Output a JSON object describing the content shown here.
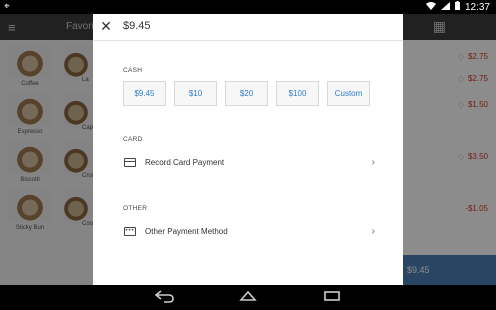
{
  "status_bar": {
    "time": "12:37",
    "left_icon": "location-icon",
    "icons": [
      "wifi-icon",
      "signal-icon",
      "battery-icon"
    ]
  },
  "background_app": {
    "toolbar_title": "Favori",
    "tiles": [
      {
        "label": "Coffee"
      },
      {
        "label": "Espresso"
      },
      {
        "label": "Biscotti"
      },
      {
        "label": "Sticky Bun"
      }
    ],
    "partial_tiles": [
      {
        "label": "La"
      },
      {
        "label": "Capp"
      },
      {
        "label": "Crois"
      },
      {
        "label": "Coo"
      }
    ],
    "cart_prices": [
      "$2.75",
      "$2.75",
      "$1.50",
      "$3.50",
      "-$1.05"
    ],
    "charge_label": "$9.45"
  },
  "dialog": {
    "title_amount": "$9.45",
    "cash": {
      "label": "CASH",
      "buttons": [
        "$9.45",
        "$10",
        "$20",
        "$100",
        "Custom"
      ]
    },
    "card": {
      "label": "CARD",
      "row_text": "Record Card Payment"
    },
    "other": {
      "label": "OTHER",
      "row_text": "Other Payment Method"
    }
  },
  "nav": {
    "back": "back-icon",
    "home": "home-icon",
    "recents": "recents-icon"
  },
  "colors": {
    "accent": "#2e7cc8",
    "price_red": "#d0392b",
    "charge_bar": "#4a7fb5"
  }
}
